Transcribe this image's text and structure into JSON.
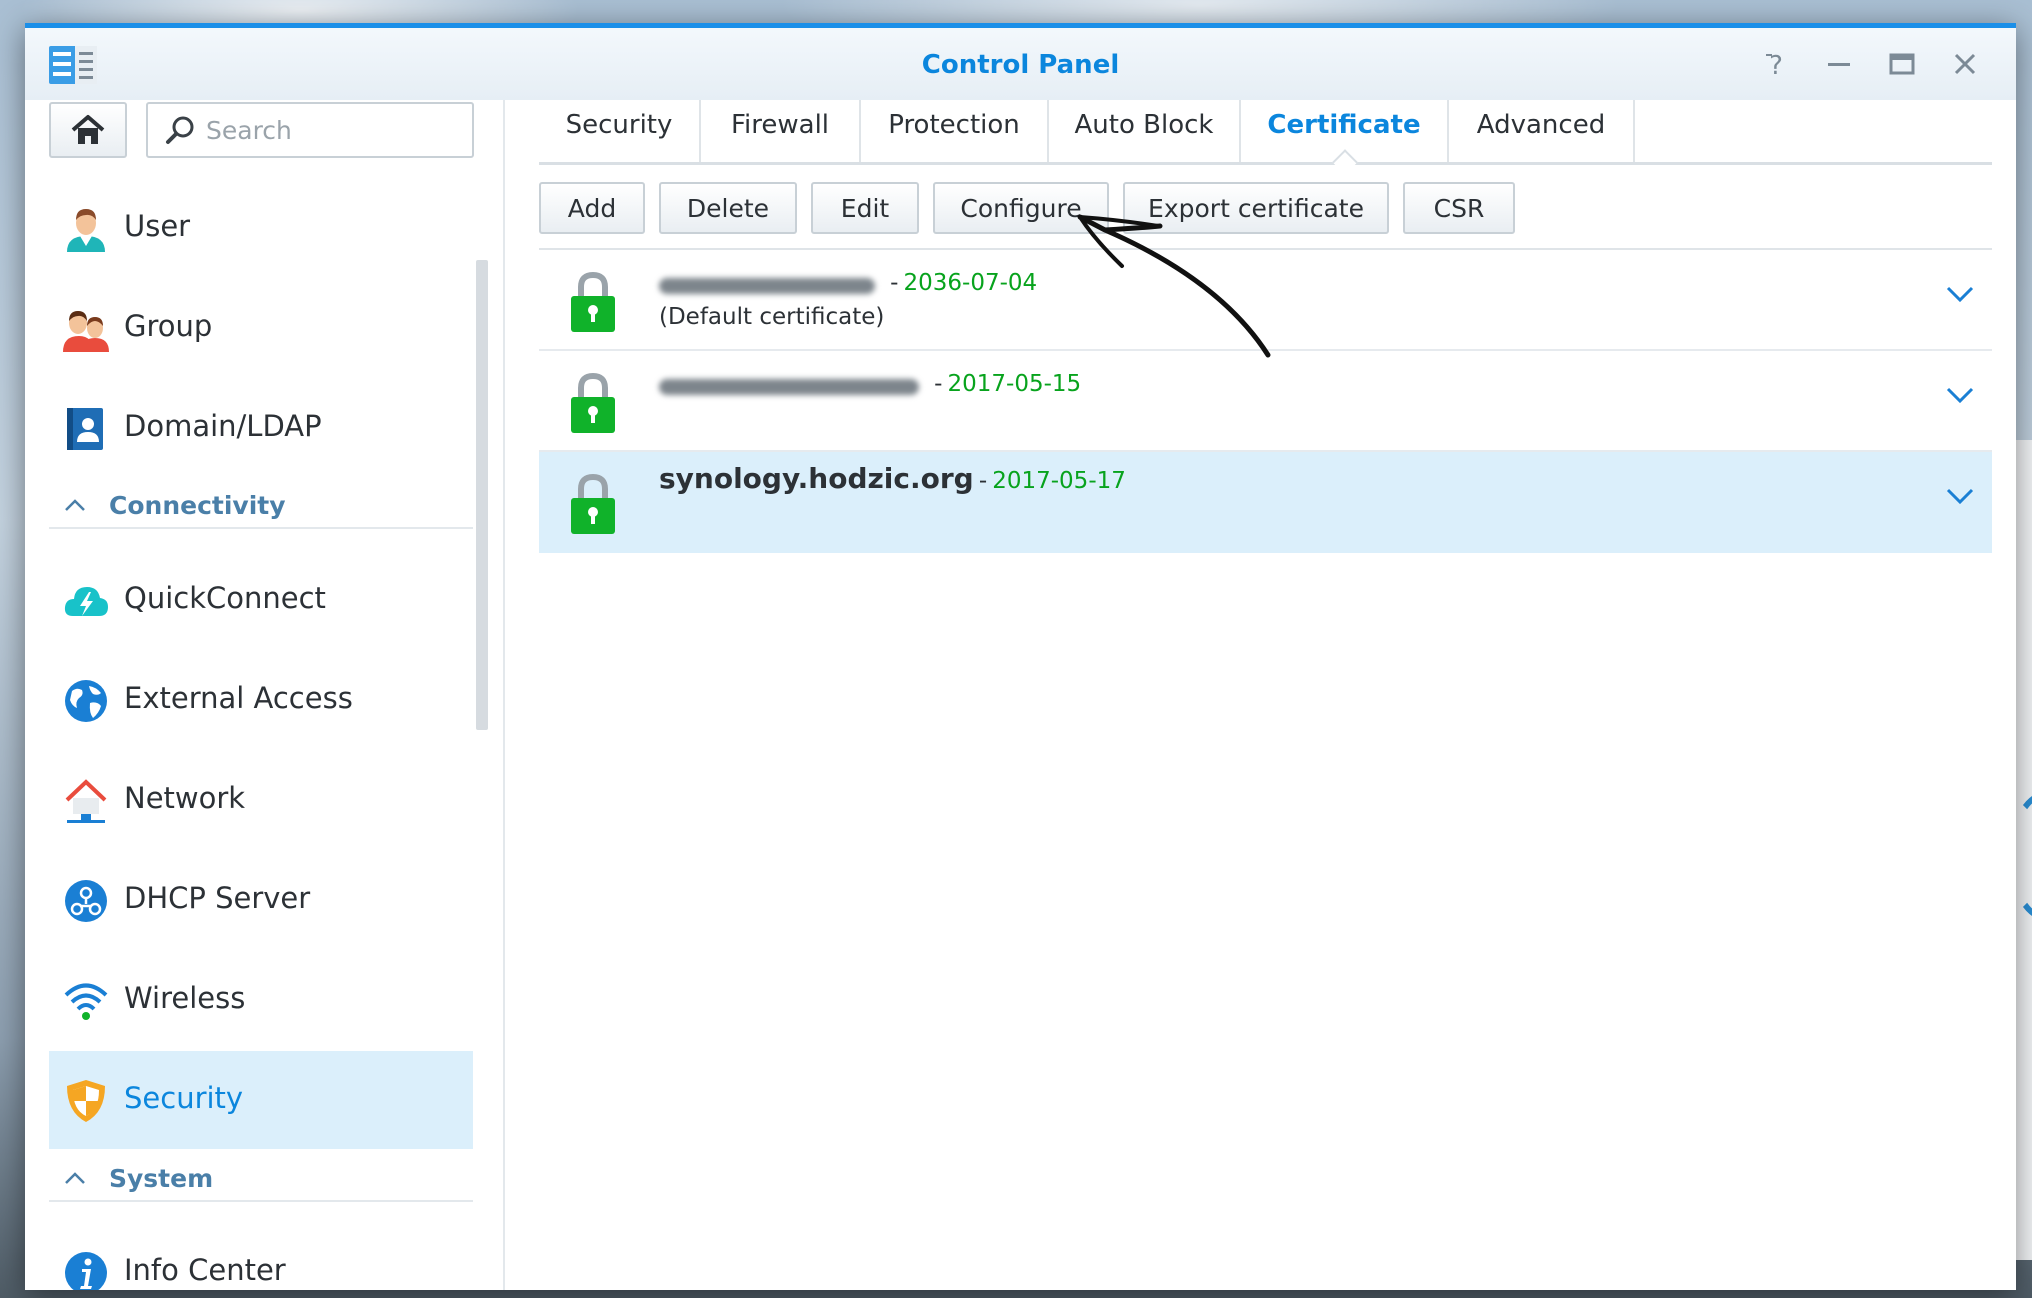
{
  "window": {
    "title": "Control Panel"
  },
  "sidebar": {
    "search_placeholder": "Search",
    "items": [
      {
        "label": "User"
      },
      {
        "label": "Group"
      },
      {
        "label": "Domain/LDAP"
      },
      {
        "label": "QuickConnect"
      },
      {
        "label": "External Access"
      },
      {
        "label": "Network"
      },
      {
        "label": "DHCP Server"
      },
      {
        "label": "Wireless"
      },
      {
        "label": "Security",
        "selected": true
      },
      {
        "label": "Info Center"
      }
    ],
    "sections": [
      {
        "label": "Connectivity"
      },
      {
        "label": "System"
      }
    ]
  },
  "tabs": [
    {
      "label": "Security"
    },
    {
      "label": "Firewall"
    },
    {
      "label": "Protection"
    },
    {
      "label": "Auto Block"
    },
    {
      "label": "Certificate",
      "active": true
    },
    {
      "label": "Advanced"
    }
  ],
  "toolbar": {
    "add": "Add",
    "delete": "Delete",
    "edit": "Edit",
    "configure": "Configure",
    "export": "Export certificate",
    "csr": "CSR"
  },
  "certificates": [
    {
      "name": "",
      "name_redacted": true,
      "sep": "-",
      "expiry": "2036-07-04",
      "note": "(Default certificate)"
    },
    {
      "name": "",
      "name_redacted": true,
      "sep": "-",
      "expiry": "2017-05-15",
      "note": ""
    },
    {
      "name": "synology.hodzic.org",
      "name_redacted": false,
      "sep": "-",
      "expiry": "2017-05-17",
      "note": "",
      "selected": true
    }
  ],
  "colors": {
    "accent": "#0b86dd",
    "date_green": "#08a31d",
    "lock_green": "#10b22a",
    "selected_bg": "#dbeffb"
  },
  "icons": {
    "home": "home-icon",
    "search": "search-icon",
    "lock": "lock-icon",
    "expand": "chevron-down-icon"
  }
}
